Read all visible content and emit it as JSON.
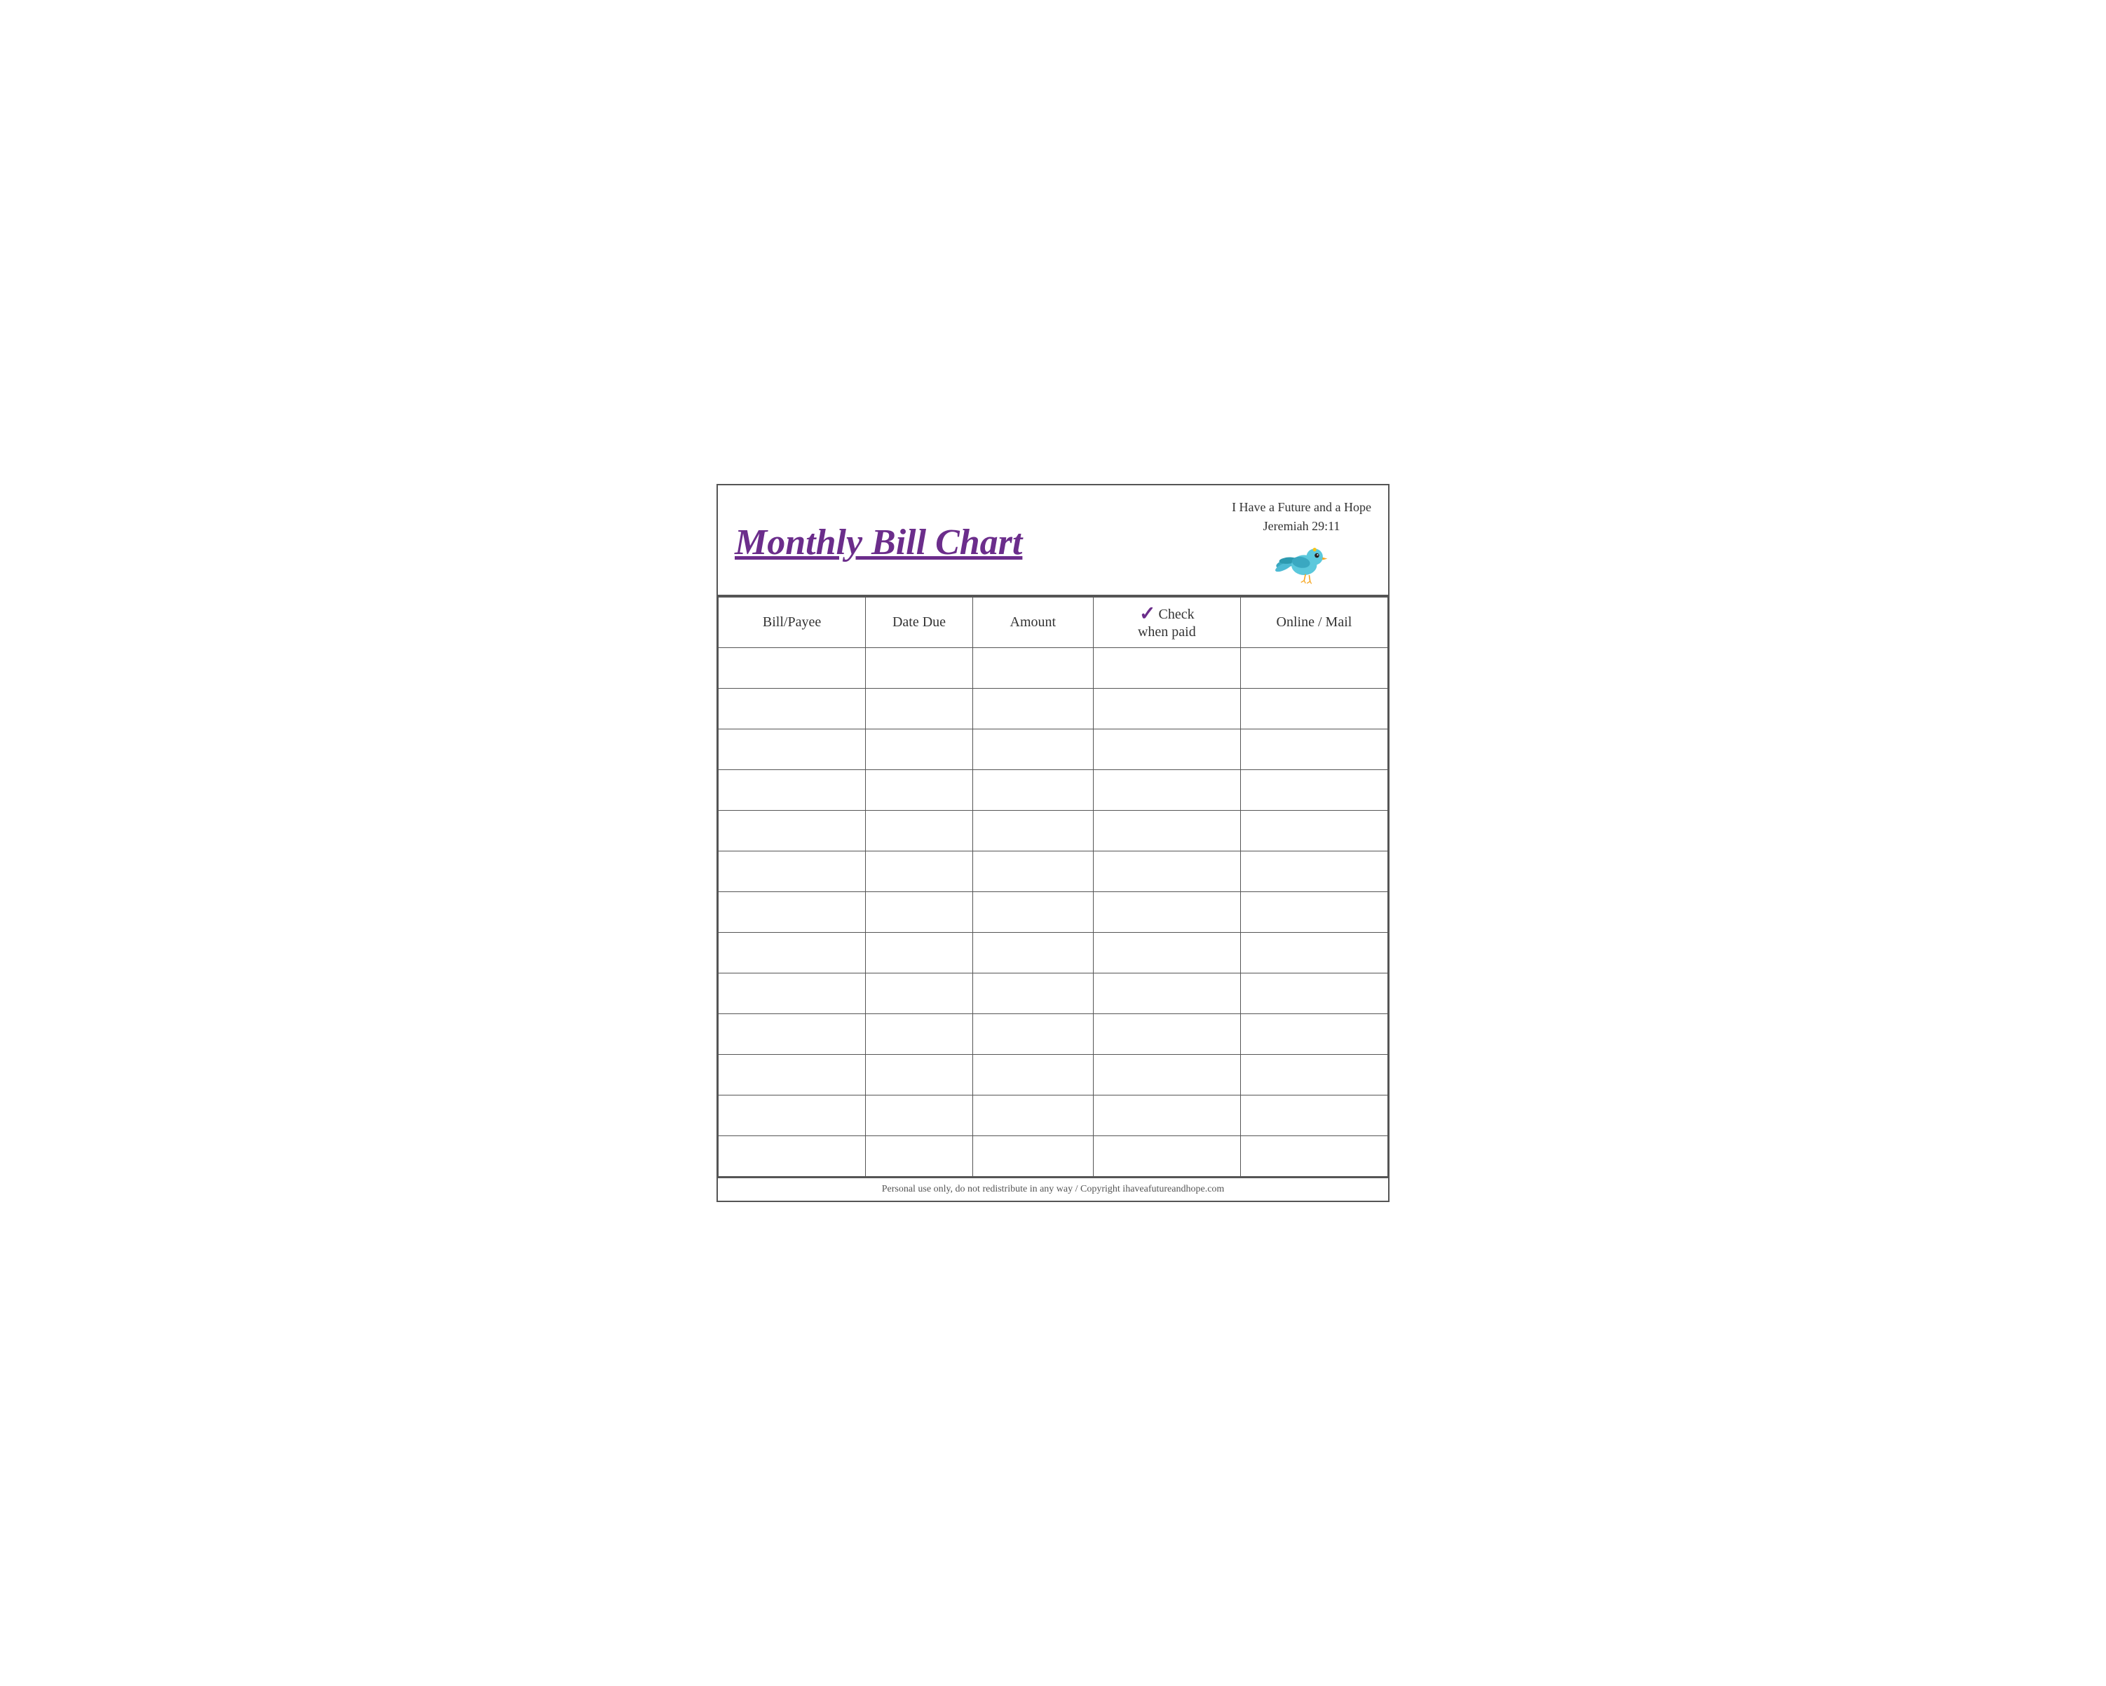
{
  "header": {
    "title": "Monthly Bill Chart",
    "scripture_line1": "I Have a Future and a Hope",
    "scripture_line2": "Jeremiah 29:11"
  },
  "columns": [
    {
      "id": "bill",
      "label": "Bill/Payee"
    },
    {
      "id": "date",
      "label": "Date Due"
    },
    {
      "id": "amount",
      "label": "Amount"
    },
    {
      "id": "check",
      "label_top": "Check",
      "label_check": "✓",
      "label_check_word": "when paid"
    },
    {
      "id": "online",
      "label": "Online / Mail"
    }
  ],
  "row_count": 13,
  "footer": {
    "text": "Personal use only, do not redistribute in any way / Copyright ihaveafutureandhope.com"
  }
}
